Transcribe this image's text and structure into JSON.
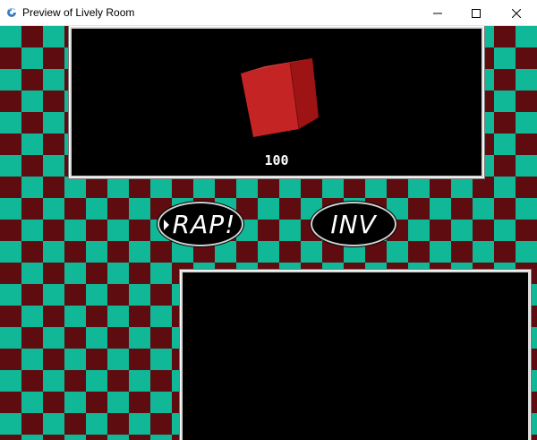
{
  "window": {
    "title": "Preview of Lively Room",
    "icon": "app-icon",
    "controls": [
      "minimize-icon",
      "maximize-icon",
      "close-icon"
    ]
  },
  "game": {
    "checker_colors": {
      "light": "#10b897",
      "dark": "#5e0c10"
    },
    "top_panel": {
      "score": "100",
      "cube_color": "#c22020"
    },
    "buttons": {
      "rap": {
        "label": "RAP!",
        "selected": true
      },
      "inv": {
        "label": "INV",
        "selected": false
      }
    },
    "bottom_panel": {}
  }
}
